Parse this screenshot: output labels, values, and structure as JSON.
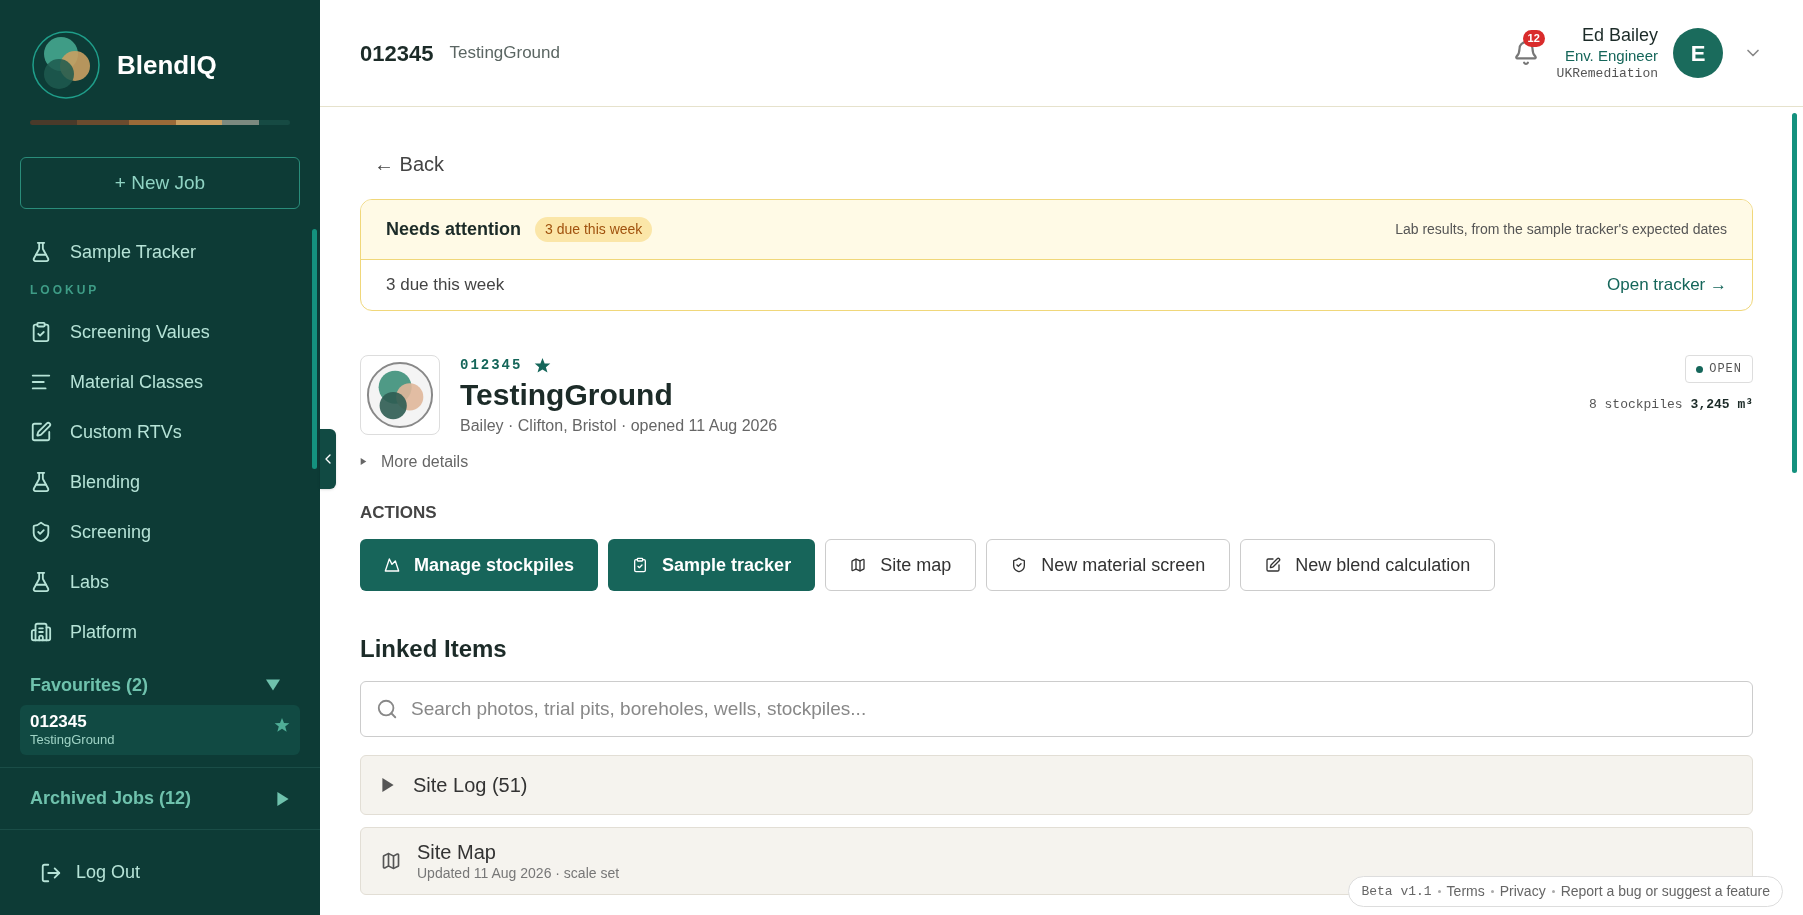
{
  "sidebar": {
    "brand": "BlendIQ",
    "new_job": "+ New Job",
    "nav": [
      {
        "kind": "link",
        "label": "Sample Tracker"
      },
      {
        "kind": "heading",
        "label": "LOOKUP"
      },
      {
        "kind": "link",
        "label": "Screening Values"
      },
      {
        "kind": "link",
        "label": "Material Classes"
      },
      {
        "kind": "link",
        "label": "Custom RTVs"
      },
      {
        "kind": "link",
        "label": "Blending"
      },
      {
        "kind": "link",
        "label": "Screening"
      },
      {
        "kind": "link",
        "label": "Labs"
      },
      {
        "kind": "link",
        "label": "Platform"
      }
    ],
    "favourites": {
      "label": "Favourites (2)",
      "expanded": true,
      "items": [
        {
          "code": "012345",
          "name": "TestingGround"
        }
      ]
    },
    "archived": {
      "label": "Archived Jobs (12)",
      "expanded": false
    },
    "logout": "Log Out"
  },
  "header": {
    "job_code": "012345",
    "job_name": "TestingGround",
    "notifications": "12",
    "user": {
      "name": "Ed Bailey",
      "role": "Env. Engineer",
      "org": "UKRemediation",
      "initial": "E"
    }
  },
  "back": "← Back",
  "attention": {
    "title": "Needs attention",
    "badge": "3 due this week",
    "note": "Lab results, from the sample tracker's expected dates",
    "summary": "3 due this week",
    "link": "Open tracker →"
  },
  "job": {
    "code": "012345",
    "starred": true,
    "name": "TestingGround",
    "meta": "Bailey · Clifton, Bristol · opened 11 Aug 2026",
    "status": "OPEN",
    "stockpiles": "8 stockpiles",
    "volume": "3,245 m³",
    "more": "More details"
  },
  "actions": {
    "heading": "ACTIONS",
    "buttons": [
      {
        "label": "Manage stockpiles",
        "primary": true
      },
      {
        "label": "Sample tracker",
        "primary": true
      },
      {
        "label": "Site map",
        "primary": false
      },
      {
        "label": "New material screen",
        "primary": false
      },
      {
        "label": "New blend calculation",
        "primary": false
      }
    ]
  },
  "linked": {
    "heading": "Linked Items",
    "search_placeholder": "Search photos, trial pits, boreholes, wells, stockpiles...",
    "sections": [
      {
        "kind": "collapsible",
        "title": "Site Log (51)",
        "expanded": false
      },
      {
        "kind": "map",
        "title": "Site Map",
        "subtitle": "Updated 11 Aug 2026 · scale set"
      }
    ]
  },
  "footer": {
    "version": "Beta v1.1",
    "links": [
      "Terms",
      "Privacy",
      "Report a bug or suggest a feature"
    ]
  }
}
